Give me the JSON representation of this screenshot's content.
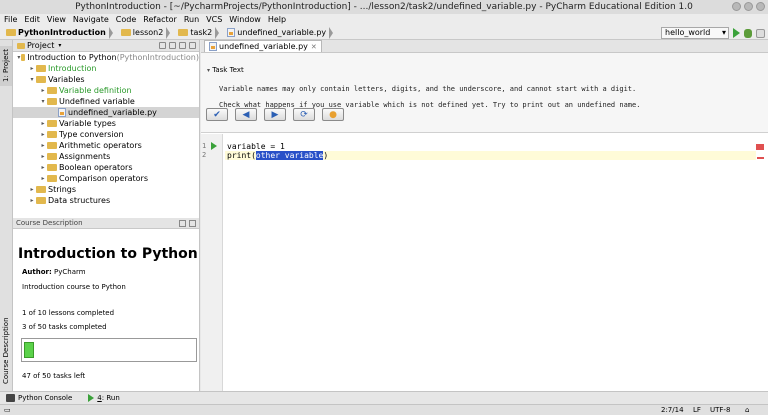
{
  "window": {
    "title": "PythonIntroduction - [~/PycharmProjects/PythonIntroduction] - .../lesson2/task2/undefined_variable.py - PyCharm Educational Edition 1.0"
  },
  "menu": [
    "File",
    "Edit",
    "View",
    "Navigate",
    "Code",
    "Refactor",
    "Run",
    "VCS",
    "Window",
    "Help"
  ],
  "breadcrumbs": [
    "PythonIntroduction",
    "lesson2",
    "task2",
    "undefined_variable.py"
  ],
  "run_config": "hello_world",
  "project_panel": {
    "title": "Project",
    "tool_tab": "1: Project",
    "tree": [
      {
        "label": "Introduction to Python",
        "suffix": " (PythonIntroduction)",
        "depth": 0,
        "arrow": "▾",
        "color": "normal",
        "icon": "folder"
      },
      {
        "label": "Introduction",
        "depth": 1,
        "arrow": "▸",
        "color": "green",
        "icon": "folder"
      },
      {
        "label": "Variables",
        "depth": 1,
        "arrow": "▾",
        "color": "normal",
        "icon": "folder"
      },
      {
        "label": "Variable definition",
        "depth": 2,
        "arrow": "▸",
        "color": "green",
        "icon": "folder"
      },
      {
        "label": "Undefined variable",
        "depth": 2,
        "arrow": "▾",
        "color": "normal",
        "icon": "folder"
      },
      {
        "label": "undefined_variable.py",
        "depth": 3,
        "arrow": "",
        "color": "normal",
        "icon": "pyfile",
        "selected": true
      },
      {
        "label": "Variable types",
        "depth": 2,
        "arrow": "▸",
        "color": "normal",
        "icon": "folder"
      },
      {
        "label": "Type conversion",
        "depth": 2,
        "arrow": "▸",
        "color": "normal",
        "icon": "folder"
      },
      {
        "label": "Arithmetic operators",
        "depth": 2,
        "arrow": "▸",
        "color": "normal",
        "icon": "folder"
      },
      {
        "label": "Assignments",
        "depth": 2,
        "arrow": "▸",
        "color": "normal",
        "icon": "folder"
      },
      {
        "label": "Boolean operators",
        "depth": 2,
        "arrow": "▸",
        "color": "normal",
        "icon": "folder"
      },
      {
        "label": "Comparison operators",
        "depth": 2,
        "arrow": "▸",
        "color": "normal",
        "icon": "folder"
      },
      {
        "label": "Strings",
        "depth": 1,
        "arrow": "▸",
        "color": "normal",
        "icon": "folder"
      },
      {
        "label": "Data structures",
        "depth": 1,
        "arrow": "▸",
        "color": "normal",
        "icon": "folder"
      }
    ]
  },
  "course": {
    "panel_title": "Course Description",
    "tool_tab": "Course Description",
    "title": "Introduction to Python",
    "author_label": "Author:",
    "author": "PyCharm",
    "description": "Introduction course to Python",
    "lessons": "1 of 10 lessons completed",
    "tasks": "3 of 50 tasks completed",
    "progress": 0.06,
    "tasks_left": "47 of 50 tasks left"
  },
  "editor": {
    "tab": "undefined_variable.py",
    "task_header": "Task Text",
    "task_lines": [
      "Variable names may only contain letters, digits, and the underscore, and cannot start with a digit.",
      "Check what happens if you use variable which is not defined yet. Try to print out an undefined name."
    ],
    "buttons": [
      "check",
      "previous",
      "next",
      "refresh",
      "hint"
    ],
    "line_numbers": [
      "1",
      "2"
    ],
    "code": {
      "line1": "variable = 1",
      "l2_pre": "print(",
      "l2_sel": "other variable",
      "l2_post": ")"
    }
  },
  "statusbar": {
    "python_console": "Python Console",
    "run_num": "4",
    "run_label": ": Run"
  },
  "bottom": {
    "position": "2:7/14",
    "line_sep": "LF",
    "encoding": "UTF-8"
  },
  "colors": {
    "green_text": "#2a9a2a",
    "selection": "#2850c8",
    "progress": "#5bd24a"
  }
}
